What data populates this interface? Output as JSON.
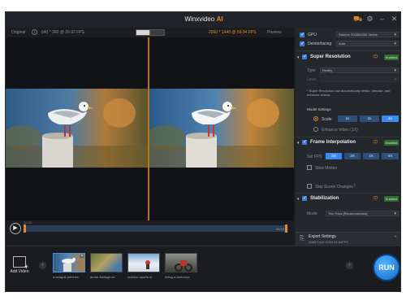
{
  "window": {
    "title": "Winxvideo",
    "title_ai": "AI"
  },
  "preview": {
    "original_label": "Original",
    "original_res": "640 * 360 @ 29.97 FPS",
    "output_res": "2560 * 1440 @ 59.94 FPS",
    "preview_label": "Preview"
  },
  "player": {
    "time_start": "00:00",
    "time_end": "00:23"
  },
  "thumbnails": [
    {
      "caption": "a-seagull-perchec"
    },
    {
      "caption": "drone-footage-ve"
    },
    {
      "caption": "outdoor-sports.m"
    },
    {
      "caption": "riding-a-motorcyc"
    }
  ],
  "add_video_label": "Add Video",
  "run_label": "RUN",
  "panel": {
    "gpu_label": "GPU",
    "gpu_value": "Radeon RX550/550 Series",
    "deinterlacing_label": "Deinterlacing",
    "deinterlacing_value": "Auto",
    "super_resolution": {
      "title": "Super Resolution",
      "badge": "Enabled",
      "type_label": "Type",
      "type_value": "Reality",
      "level_label": "Level",
      "note": "* Super Resolution can automatically deblur, denoise, and enhance videos.",
      "model_settings": "Model Settings",
      "scale_label": "Scale",
      "scale_options": [
        "2x",
        "3x",
        "4x"
      ],
      "enhance_label": "Enhance Video (1X)"
    },
    "frame_interpolation": {
      "title": "Frame Interpolation",
      "badge": "Enabled",
      "set_fps_label": "Set FPS",
      "fps_options": [
        "2X",
        "3X",
        "4X",
        "5X"
      ],
      "slow_motion": "Slow Motion",
      "skip_scene": "Skip Scene Changes"
    },
    "stabilization": {
      "title": "Stabilization",
      "badge": "Enabled",
      "mode_label": "Mode",
      "mode_value": "Two Pass (Recommended)"
    },
    "export": {
      "title": "Export Settings",
      "detail": "2560*1440  H264  59.94FPS"
    }
  },
  "colors": {
    "accent": "#e08a2a",
    "run_blue": "#1e7ee0",
    "enabled_green": "#2f6b2f"
  }
}
